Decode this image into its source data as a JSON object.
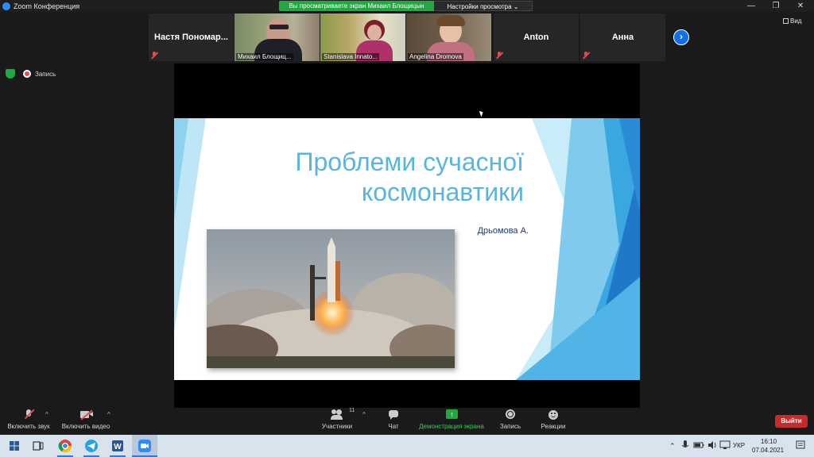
{
  "window": {
    "title": "Zoom Конференция",
    "minimize": "—",
    "maximize": "❐",
    "close": "✕"
  },
  "share_banner": {
    "text": "Вы просматриваете экран Михаил Блощицын",
    "view_options": "Настройки просмотра ⌄"
  },
  "gallery": {
    "tiles": [
      {
        "name": "Настя  Пономар...",
        "type": "name",
        "muted": true
      },
      {
        "label": "Михаил Блощиц...",
        "type": "video"
      },
      {
        "label": "Stanislava Innato...",
        "type": "video"
      },
      {
        "label": "Angelina Dromova",
        "type": "video"
      },
      {
        "name": "Anton",
        "type": "name",
        "muted": true
      },
      {
        "name": "Анна",
        "type": "name",
        "muted": true
      }
    ],
    "next_icon": "›",
    "view_label": "Вид"
  },
  "indicators": {
    "recording_label": "Запись"
  },
  "slide": {
    "title_line1": "Проблеми сучасної",
    "title_line2": "космонавтики",
    "author": "Дрьомова А."
  },
  "toolbar": {
    "audio": "Включить звук",
    "video": "Включить видео",
    "participants": "Участники",
    "participants_count": "11",
    "chat": "Чат",
    "share": "Демонстрация экрана",
    "record": "Запись",
    "reactions": "Реакции",
    "leave": "Выйти",
    "caret": "^"
  },
  "taskbar": {
    "language": "УКР",
    "time": "16:10",
    "date": "07.04.2021"
  },
  "colors": {
    "accent_blue": "#0e71eb",
    "share_green": "#23a841",
    "leave_red": "#c62a2a",
    "slide_title": "#59b5de"
  }
}
